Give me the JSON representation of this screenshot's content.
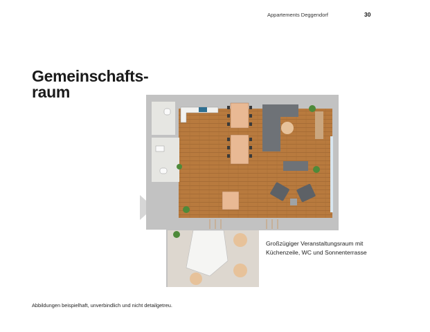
{
  "header": {
    "title": "Appartements Deggendorf",
    "page_number": "30"
  },
  "heading": {
    "line1": "Gemeinschafts-",
    "line2": "raum"
  },
  "caption": {
    "line1": "Großzügiger Veranstaltungsraum mit",
    "line2": "Küchenzeile, WC und Sonnenterrasse"
  },
  "disclaimer": "Abbildungen beispielhaft, unverbindlich und nicht detailgetreu.",
  "colors": {
    "wall": "#bdbdbd",
    "floor": "#b87a3e",
    "tile": "#e6e6e2",
    "terrace": "#ddd7cf",
    "arrow": "#d6d6d6"
  }
}
